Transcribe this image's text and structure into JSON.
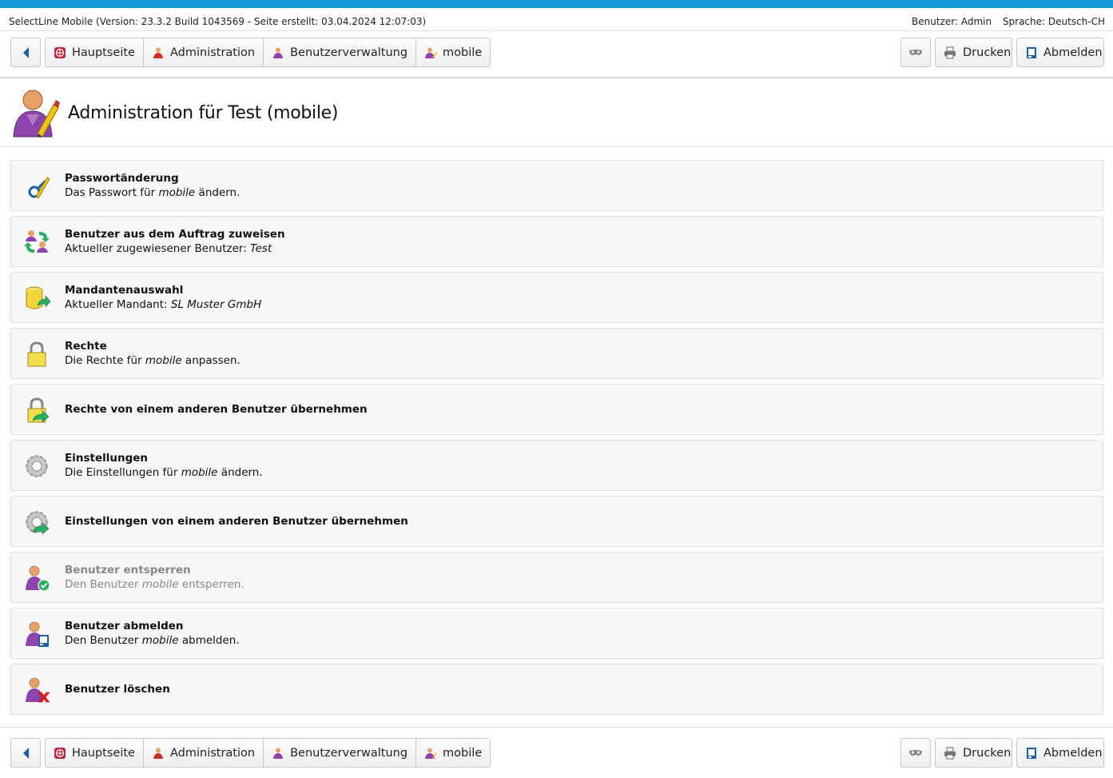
{
  "info": {
    "app_version": "SelectLine Mobile (Version: 23.3.2 Build 1043569 - Seite erstellt: 03.04.2024 12:07:03)",
    "user": "Benutzer: Admin",
    "language": "Sprache: Deutsch-CH"
  },
  "nav": {
    "breadcrumbs": [
      {
        "label": "Hauptseite",
        "icon": "home-globe-icon"
      },
      {
        "label": "Administration",
        "icon": "admin-user-icon"
      },
      {
        "label": "Benutzerverwaltung",
        "icon": "user-management-icon"
      },
      {
        "label": "mobile",
        "icon": "user-edit-icon"
      }
    ],
    "print_label": "Drucken",
    "logout_label": "Abmelden"
  },
  "page": {
    "title": "Administration für Test (mobile)"
  },
  "items": [
    {
      "title": "Passwortänderung",
      "desc_pre": "Das Passwort für ",
      "desc_em": "mobile",
      "desc_post": " ändern.",
      "icon": "password-change-icon",
      "enabled": true
    },
    {
      "title": "Benutzer aus dem Auftrag zuweisen",
      "desc_pre": "Aktueller zugewiesener Benutzer: ",
      "desc_em": "Test",
      "desc_post": "",
      "icon": "assign-user-icon",
      "enabled": true
    },
    {
      "title": "Mandantenauswahl",
      "desc_pre": "Aktueller Mandant: ",
      "desc_em": "SL Muster GmbH",
      "desc_post": "",
      "icon": "database-select-icon",
      "enabled": true
    },
    {
      "title": "Rechte",
      "desc_pre": "Die Rechte für ",
      "desc_em": "mobile",
      "desc_post": " anpassen.",
      "icon": "lock-icon",
      "enabled": true
    },
    {
      "title": "Rechte von einem anderen Benutzer übernehmen",
      "desc_pre": "",
      "desc_em": "",
      "desc_post": "",
      "icon": "lock-transfer-icon",
      "enabled": true
    },
    {
      "title": "Einstellungen",
      "desc_pre": "Die Einstellungen für ",
      "desc_em": "mobile",
      "desc_post": " ändern.",
      "icon": "gear-icon",
      "enabled": true
    },
    {
      "title": "Einstellungen von einem anderen Benutzer übernehmen",
      "desc_pre": "",
      "desc_em": "",
      "desc_post": "",
      "icon": "gear-transfer-icon",
      "enabled": true
    },
    {
      "title": "Benutzer entsperren",
      "desc_pre": "Den Benutzer ",
      "desc_em": "mobile",
      "desc_post": " entsperren.",
      "icon": "user-unlock-icon",
      "enabled": false
    },
    {
      "title": "Benutzer abmelden",
      "desc_pre": "Den Benutzer ",
      "desc_em": "mobile",
      "desc_post": " abmelden.",
      "icon": "user-logout-icon",
      "enabled": true
    },
    {
      "title": "Benutzer löschen",
      "desc_pre": "",
      "desc_em": "",
      "desc_post": "",
      "icon": "user-delete-icon",
      "enabled": true
    }
  ],
  "colors": {
    "accent": "#139ad6",
    "disabled_text": "#888888"
  }
}
